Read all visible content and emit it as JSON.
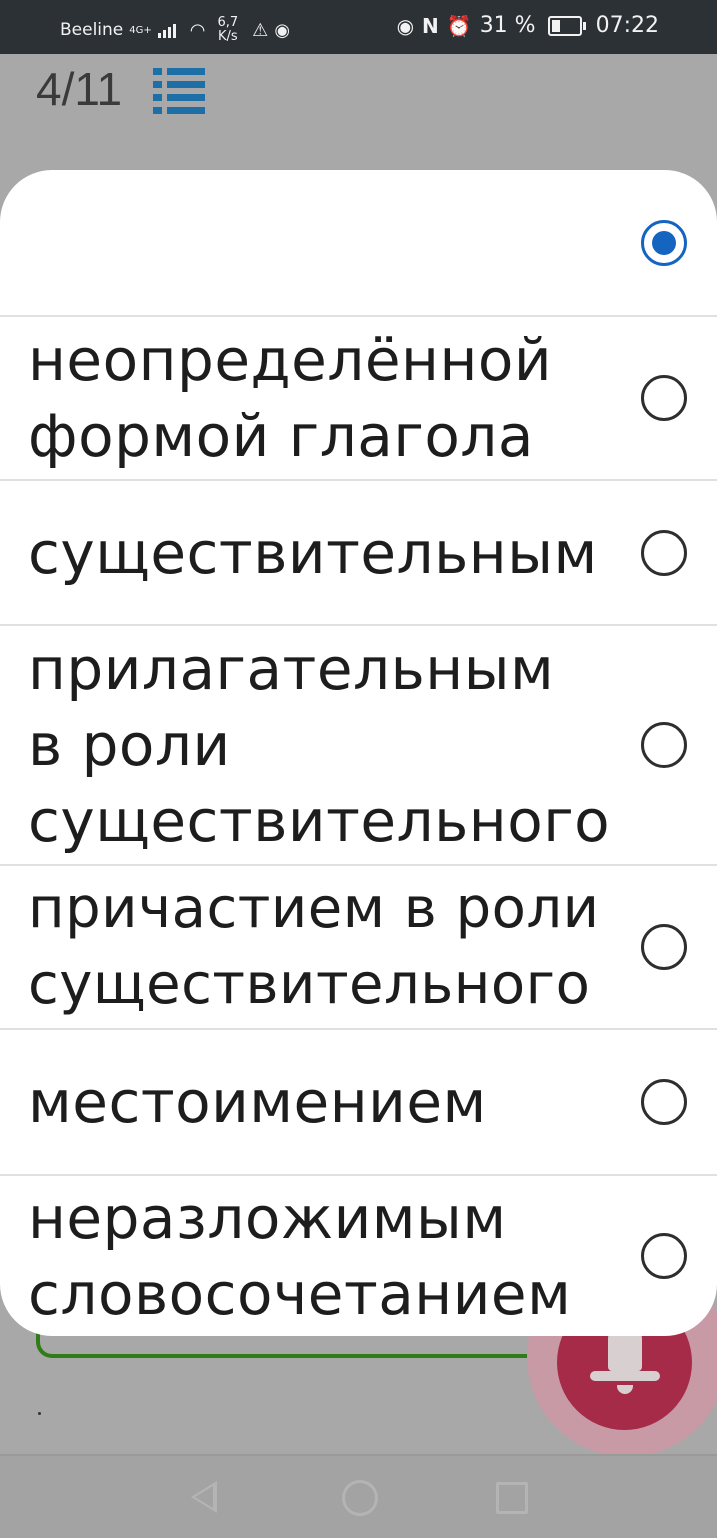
{
  "status_bar": {
    "carrier": "Beeline",
    "network": "4G+",
    "speed_value": "6,7",
    "speed_unit": "K/s",
    "battery": "31 %",
    "time": "07:22"
  },
  "header": {
    "progress": "4/11"
  },
  "options": [
    {
      "label": "",
      "selected": true
    },
    {
      "label": "неопределённой формой глагола",
      "selected": false
    },
    {
      "label": "существительным",
      "selected": false
    },
    {
      "label": "прилагательным в роли существительного",
      "selected": false
    },
    {
      "label": "причастием в роли существительного",
      "selected": false
    },
    {
      "label": "местоимением",
      "selected": false
    },
    {
      "label": "неразложимым словосочетанием",
      "selected": false
    }
  ],
  "background_text": {
    "dot": "."
  },
  "colors": {
    "accent": "#1565c0",
    "fab": "#a52b48",
    "status_bar": "#2b3135"
  }
}
